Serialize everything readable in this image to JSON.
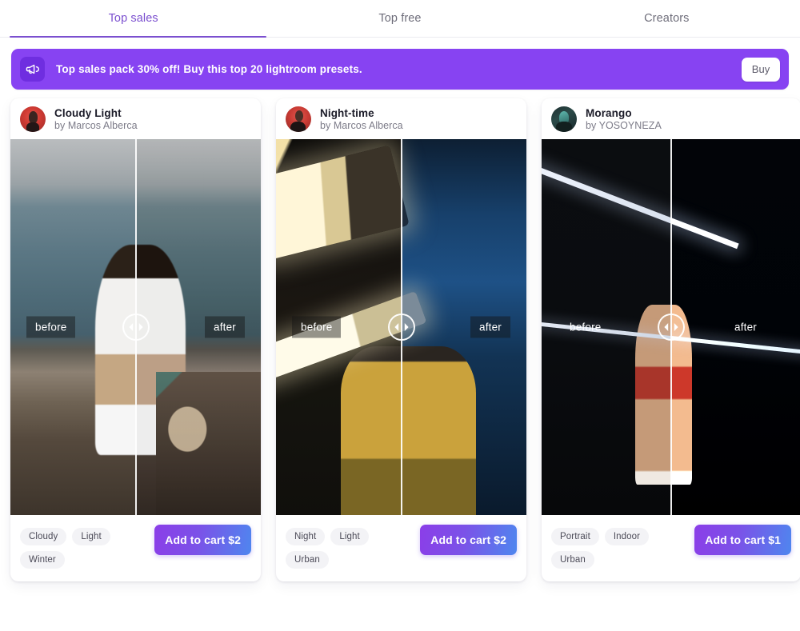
{
  "tabs": [
    {
      "label": "Top sales",
      "active": true
    },
    {
      "label": "Top free",
      "active": false
    },
    {
      "label": "Creators",
      "active": false
    }
  ],
  "banner": {
    "icon": "megaphone-icon",
    "text": "Top sales pack 30% off! Buy this top 20 lightroom presets.",
    "button_label": "Buy",
    "background_color": "#8743f2",
    "icon_background_color": "#6f2ee0",
    "text_color": "#ffffff"
  },
  "accent_color": "#7b4fcf",
  "compare_labels": {
    "before": "before",
    "after": "after"
  },
  "cards": [
    {
      "title": "Cloudy Light",
      "author": "by Marcos Alberca",
      "avatar": "avatar-marcos-alberca",
      "before_label": "before",
      "after_label": "after",
      "tags": [
        "Cloudy",
        "Light",
        "Winter"
      ],
      "cart_label": "Add to cart $2",
      "price": "$2"
    },
    {
      "title": "Night-time",
      "author": "by Marcos Alberca",
      "avatar": "avatar-marcos-alberca",
      "before_label": "before",
      "after_label": "after",
      "tags": [
        "Night",
        "Light",
        "Urban"
      ],
      "cart_label": "Add to cart $2",
      "price": "$2"
    },
    {
      "title": "Morango",
      "author": "by YOSOYNEZA",
      "avatar": "avatar-yosoyneza",
      "before_label": "before",
      "after_label": "after",
      "tags": [
        "Portrait",
        "Indoor",
        "Urban"
      ],
      "cart_label": "Add to cart $1",
      "price": "$1"
    }
  ]
}
